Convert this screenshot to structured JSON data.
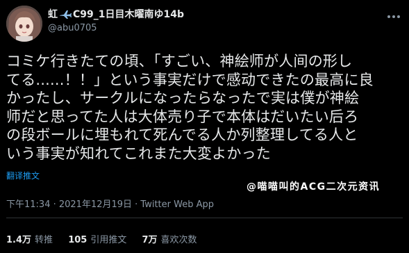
{
  "user": {
    "display_name_part1": "虹",
    "display_name_part2": "C99_1日目木曜南ゆ14b",
    "handle": "@abu0705"
  },
  "tweet": {
    "lines": [
      "コミケ行きたての頃、「すごい、神絵师が人间の形し",
      "てる......！！」という事実だけで感动できたの最高に良",
      "かったし、サークルになったらなったで実は僕が神絵",
      "师だと思ってた人は大体売り子で本体はだいたい后ろ",
      "の段ボールに埋もれて死んでる人か列整理してる人と",
      "いう事実が知れてこれまた大変よかった"
    ],
    "translate_label": "翻译推文"
  },
  "watermark": "@喵喵叫的ACG二次元资讯",
  "meta": "下午11:34 · 2021年12月19日 · Twitter Web App",
  "stats": {
    "retweets": {
      "num": "1.4万",
      "label": "转推"
    },
    "quotes": {
      "num": "105",
      "label": "引用推文"
    },
    "likes": {
      "num": "7万",
      "label": "喜欢次数"
    }
  },
  "icons": [
    "avatar",
    "airplane-icon",
    "more-icon"
  ],
  "colors": {
    "background": "#000000",
    "text": "#e7e9ea",
    "secondary": "#8b98a5",
    "link": "#1d9bf0",
    "divider": "#2f3336"
  }
}
